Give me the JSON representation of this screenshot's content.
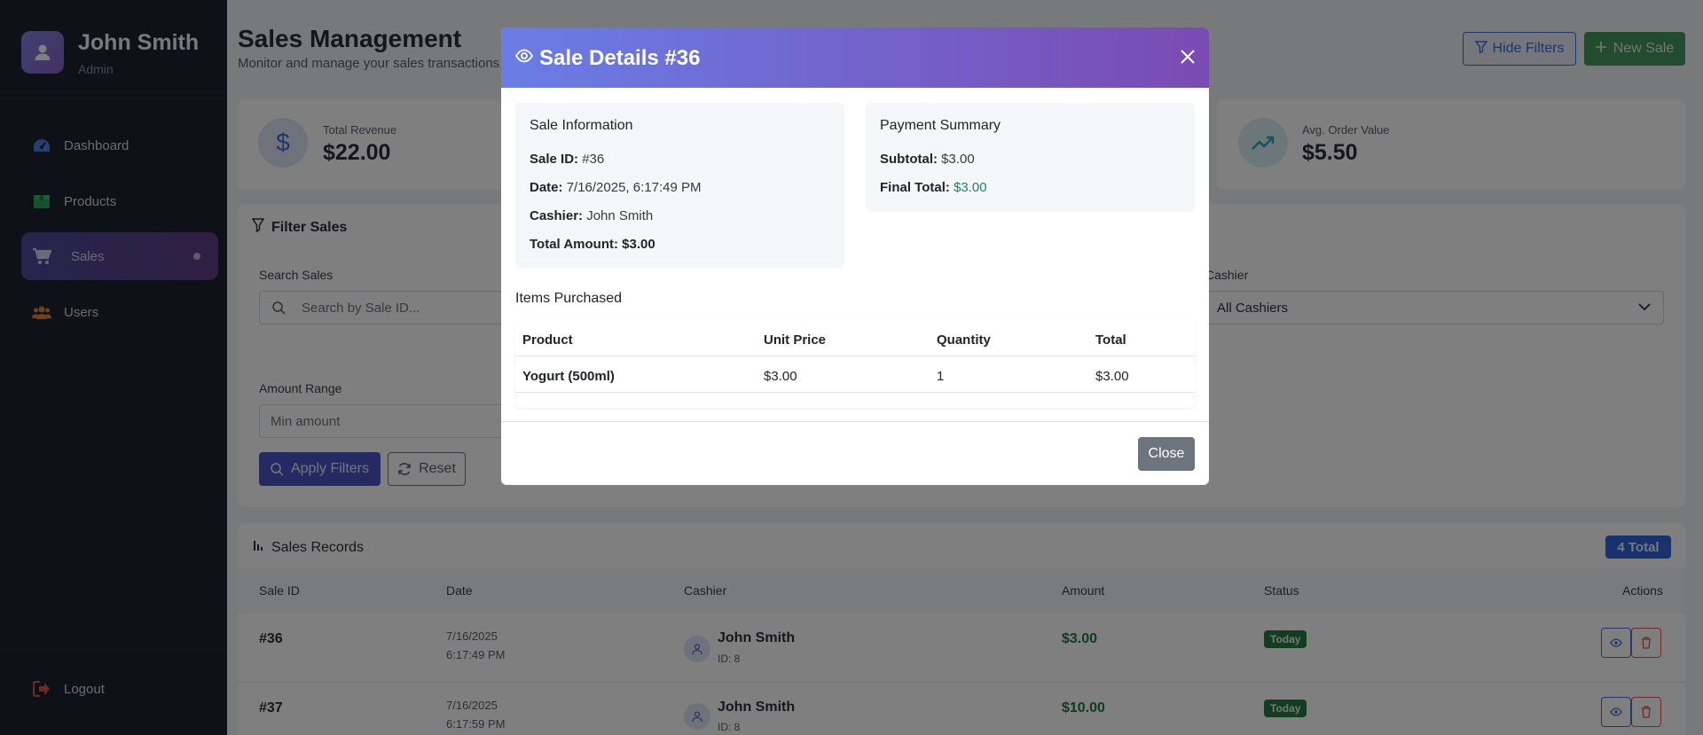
{
  "user": {
    "name": "John Smith",
    "role": "Admin"
  },
  "nav": [
    {
      "label": "Dashboard",
      "icon": "gauge-icon"
    },
    {
      "label": "Products",
      "icon": "box-icon"
    },
    {
      "label": "Sales",
      "icon": "cart-icon"
    },
    {
      "label": "Users",
      "icon": "users-icon"
    }
  ],
  "logout_label": "Logout",
  "header": {
    "title": "Sales Management",
    "subtitle": "Monitor and manage your sales transactions",
    "hide_filters_label": "Hide Filters",
    "new_sale_label": "New Sale"
  },
  "stats": {
    "revenue": {
      "label": "Total Revenue",
      "value": "$22.00"
    },
    "avg_order": {
      "label": "Avg. Order Value",
      "value": "$5.50"
    }
  },
  "filters": {
    "title": "Filter Sales",
    "search_label": "Search Sales",
    "search_placeholder": "Search by Sale ID...",
    "cashier_label": "Cashier",
    "cashier_value": "All Cashiers",
    "amount_label": "Amount Range",
    "min_placeholder": "Min amount",
    "apply_label": "Apply Filters",
    "reset_label": "Reset"
  },
  "records": {
    "title": "Sales Records",
    "total_badge": "4 Total",
    "columns": [
      "Sale ID",
      "Date",
      "Cashier",
      "Amount",
      "Status",
      "Actions"
    ],
    "rows": [
      {
        "id": "#36",
        "date": "7/16/2025",
        "time": "6:17:49 PM",
        "cashier": "John Smith",
        "cashier_id": "ID: 8",
        "amount": "$3.00",
        "status": "Today"
      },
      {
        "id": "#37",
        "date": "7/16/2025",
        "time": "6:17:59 PM",
        "cashier": "John Smith",
        "cashier_id": "ID: 8",
        "amount": "$10.00",
        "status": "Today"
      }
    ]
  },
  "modal": {
    "title": "Sale Details #36",
    "sale_info": {
      "heading": "Sale Information",
      "sale_id_label": "Sale ID:",
      "sale_id": "#36",
      "date_label": "Date:",
      "date": "7/16/2025, 6:17:49 PM",
      "cashier_label": "Cashier:",
      "cashier": "John Smith",
      "total_label": "Total Amount:",
      "total": "$3.00"
    },
    "payment": {
      "heading": "Payment Summary",
      "subtotal_label": "Subtotal:",
      "subtotal": "$3.00",
      "final_label": "Final Total:",
      "final": "$3.00"
    },
    "items_heading": "Items Purchased",
    "items_columns": [
      "Product",
      "Unit Price",
      "Quantity",
      "Total"
    ],
    "items": [
      {
        "product": "Yogurt (500ml)",
        "unit_price": "$3.00",
        "quantity": "1",
        "total": "$3.00"
      }
    ],
    "close_label": "Close"
  }
}
